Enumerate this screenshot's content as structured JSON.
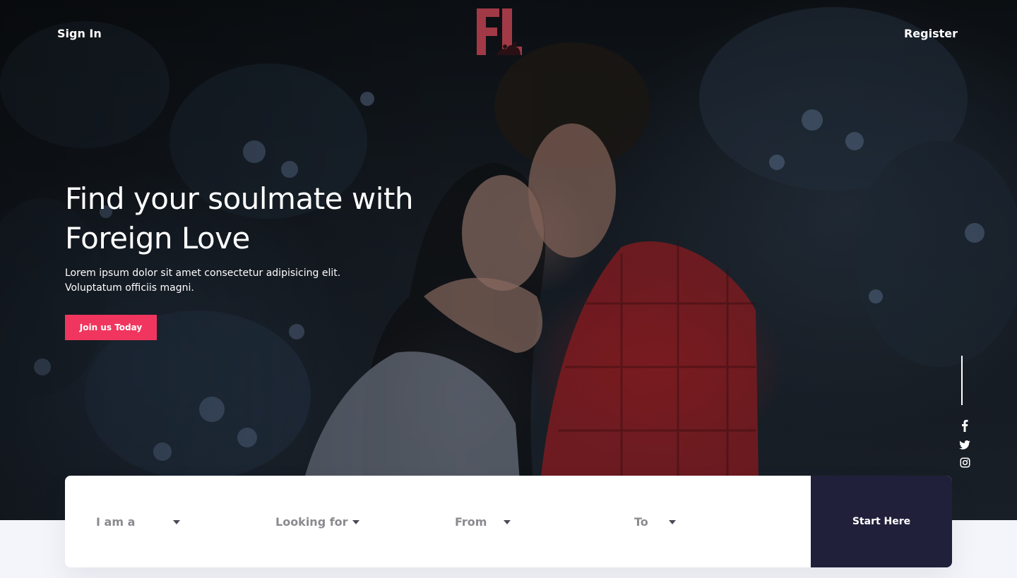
{
  "nav": {
    "sign_in": "Sign In",
    "register": "Register"
  },
  "logo": {
    "text": "FL",
    "color": "#a13a46"
  },
  "hero": {
    "headline": "Find your soulmate with Foreign Love",
    "subtext": "Lorem ipsum dolor sit amet consectetur adipisicing elit. Voluptatum officiis magni.",
    "cta_label": "Join us Today",
    "cta_color": "#f0365e"
  },
  "social": {
    "icons": [
      "facebook-icon",
      "twitter-icon",
      "instagram-icon"
    ]
  },
  "search": {
    "fields": [
      {
        "label": "I am a"
      },
      {
        "label": "Looking for"
      },
      {
        "label": "From"
      },
      {
        "label": "To"
      }
    ],
    "submit_label": "Start Here",
    "submit_color": "#20203a"
  }
}
